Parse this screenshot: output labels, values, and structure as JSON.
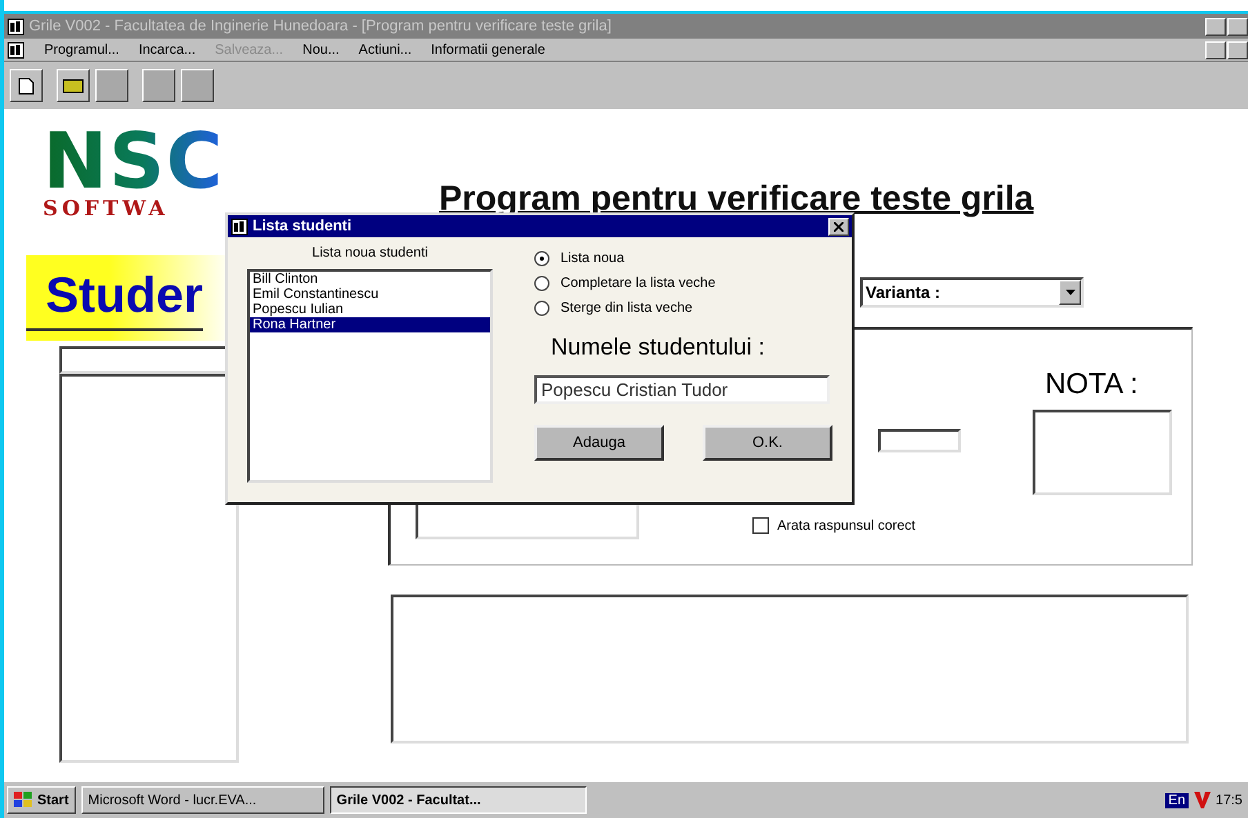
{
  "window": {
    "title": "Grile V002 - Facultatea de Inginerie Hunedoara - [Program pentru verificare teste grila]"
  },
  "menu": [
    {
      "label": "Programul...",
      "disabled": false
    },
    {
      "label": "Incarca...",
      "disabled": false
    },
    {
      "label": "Salveaza...",
      "disabled": true
    },
    {
      "label": "Nou...",
      "disabled": false
    },
    {
      "label": "Actiuni...",
      "disabled": false
    },
    {
      "label": "Informatii generale",
      "disabled": false
    }
  ],
  "logo": {
    "letters": "NSC",
    "sub": "SOFTWA"
  },
  "heading": "Program pentru verificare teste grila",
  "student_label": "Studer",
  "varianta": {
    "label": "Varianta :"
  },
  "nota_label": "NOTA :",
  "show_answer": {
    "label": "Arata raspunsul corect",
    "checked": false
  },
  "dialog": {
    "title": "Lista studenti",
    "list_label": "Lista noua studenti",
    "students": [
      {
        "name": "Bill Clinton",
        "selected": false
      },
      {
        "name": "Emil Constantinescu",
        "selected": false
      },
      {
        "name": "Popescu Iulian",
        "selected": false
      },
      {
        "name": "Rona Hartner",
        "selected": true
      }
    ],
    "options": [
      {
        "label": "Lista noua",
        "selected": true
      },
      {
        "label": "Completare la lista veche",
        "selected": false
      },
      {
        "label": "Sterge din lista veche",
        "selected": false
      }
    ],
    "name_label": "Numele studentului :",
    "name_value": "Popescu Cristian Tudor",
    "buttons": [
      "Adauga",
      "O.K."
    ]
  },
  "taskbar": {
    "start": "Start",
    "tasks": [
      {
        "label": "Microsoft Word - lucr.EVA...",
        "selected": false
      },
      {
        "label": "Grile V002 - Facultat...",
        "selected": true
      }
    ],
    "lang": "En",
    "clock": "17:5"
  }
}
